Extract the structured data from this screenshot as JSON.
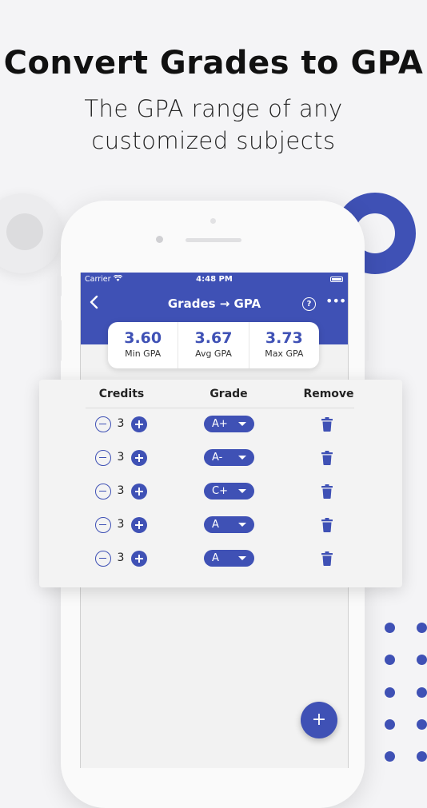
{
  "promo": {
    "headline": "Convert Grades to GPA",
    "subline": "The GPA range of any customized subjects"
  },
  "status_bar": {
    "carrier": "Carrier",
    "time": "4:48 PM"
  },
  "app_bar": {
    "title": "Grades → GPA",
    "back_icon": "chevron-left-icon",
    "help_icon": "help-circle-icon",
    "more_icon": "more-horizontal-icon"
  },
  "summary": {
    "min": {
      "value": "3.60",
      "label": "Min GPA"
    },
    "avg": {
      "value": "3.67",
      "label": "Avg GPA"
    },
    "max": {
      "value": "3.73",
      "label": "Max GPA"
    }
  },
  "table": {
    "headers": {
      "credits": "Credits",
      "grade": "Grade",
      "remove": "Remove"
    },
    "rows": [
      {
        "credits": "3",
        "grade": "A+"
      },
      {
        "credits": "3",
        "grade": "A-"
      },
      {
        "credits": "3",
        "grade": "C+"
      },
      {
        "credits": "3",
        "grade": "A"
      },
      {
        "credits": "3",
        "grade": "A"
      }
    ]
  },
  "fab": {
    "label": "+",
    "icon": "plus-icon"
  },
  "colors": {
    "accent": "#3f51b5",
    "background": "#f4f4f6"
  }
}
